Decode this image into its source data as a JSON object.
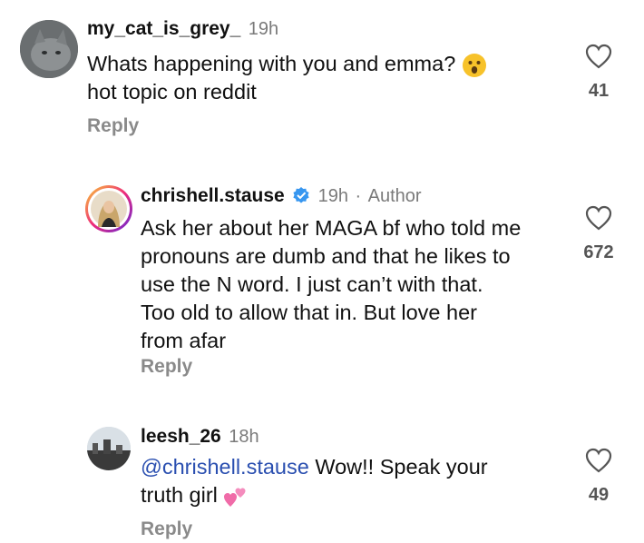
{
  "comments": [
    {
      "username": "my_cat_is_grey_",
      "time": "19h",
      "text_line1": "Whats happening with you and emma?",
      "text_line2": "hot topic on reddit",
      "emoji": "hushed-face-emoji",
      "likes": "41",
      "reply_label": "Reply"
    },
    {
      "username": "chrishell.stause",
      "verified": true,
      "time": "19h",
      "separator": "·",
      "author_label": "Author",
      "lines": [
        "Ask her about her MAGA bf who told me",
        "pronouns are dumb and that he likes to",
        "use the N word. I just can’t with that.",
        "Too old to allow that in. But love her",
        "from afar"
      ],
      "likes": "672",
      "reply_label": "Reply"
    },
    {
      "username": "leesh_26",
      "time": "18h",
      "mention": "@chrishell.stause",
      "text_after_mention": " Wow!! Speak your",
      "text_line2": "truth girl",
      "emoji": "two-hearts-emoji",
      "likes": "49",
      "reply_label": "Reply"
    }
  ],
  "colors": {
    "verified_blue": "#3897f0",
    "mention": "#2a4fb0",
    "muted": "#8a8a8a"
  }
}
